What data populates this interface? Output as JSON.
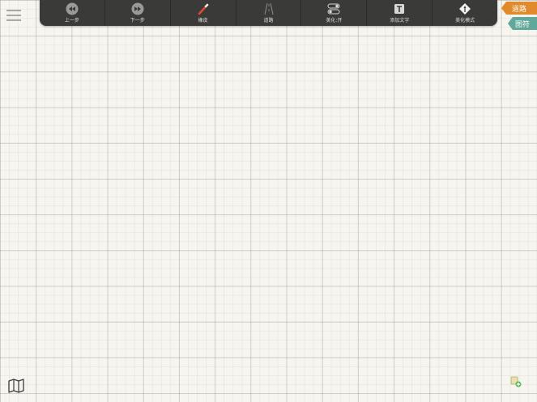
{
  "toolbar": {
    "items": [
      {
        "label": "上一步",
        "icon": "undo-icon"
      },
      {
        "label": "下一步",
        "icon": "redo-icon"
      },
      {
        "label": "橡皮",
        "icon": "eraser-icon"
      },
      {
        "label": "道路",
        "icon": "road-icon"
      },
      {
        "label": "美化:开",
        "icon": "toggle-icon"
      },
      {
        "label": "添加文字",
        "icon": "text-icon"
      },
      {
        "label": "美化模式",
        "icon": "beautify-mode-icon"
      }
    ]
  },
  "side_tabs": {
    "road": "道路",
    "symbol": "图符"
  },
  "colors": {
    "toolbar_bg": "#3a3a38",
    "road_tab": "#e08a2c",
    "symbol_tab": "#5fa89a",
    "canvas_bg": "#f6f5f0"
  }
}
